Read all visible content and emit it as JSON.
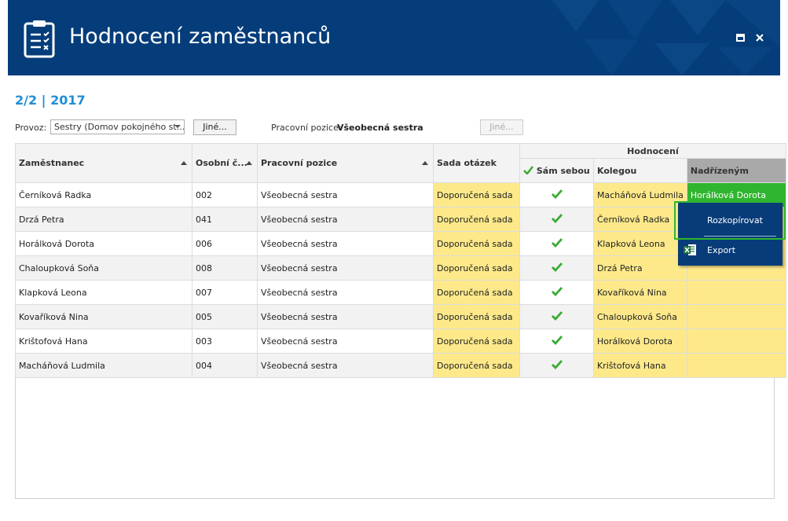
{
  "window": {
    "title": "Hodnocení zaměstnanců",
    "icon": "clipboard-checklist-icon",
    "controls": [
      "maximize-icon",
      "close-icon"
    ],
    "accent_color": "#053d7a"
  },
  "period": "2/2 | 2017",
  "filters": {
    "provoz_label": "Provoz:",
    "provoz_value": "Sestry (Domov pokojného st...",
    "provoz_button": "Jiné...",
    "pozice_label": "Pracovní pozice:",
    "pozice_value": "Všeobecná sestra",
    "pozice_button": "Jiné..."
  },
  "table": {
    "group_header": "Hodnocení",
    "headers": {
      "employee": "Zaměstnanec",
      "personal_no": "Osobní č...",
      "position": "Pracovní pozice",
      "question_set": "Sada otázek",
      "self": "Sám sebou",
      "colleague": "Kolegou",
      "superior": "Nadřízeným"
    },
    "rows": [
      {
        "employee": "Černíková Radka",
        "no": "002",
        "position": "Všeobecná sestra",
        "set": "Doporučená sada",
        "colleague": "Macháňová Ludmila",
        "superior": "Horálková Dorota"
      },
      {
        "employee": "Drzá Petra",
        "no": "041",
        "position": "Všeobecná sestra",
        "set": "Doporučená sada",
        "colleague": "Černíková Radka",
        "superior": ""
      },
      {
        "employee": "Horálková Dorota",
        "no": "006",
        "position": "Všeobecná sestra",
        "set": "Doporučená sada",
        "colleague": "Klapková Leona",
        "superior": ""
      },
      {
        "employee": "Chaloupková Soňa",
        "no": "008",
        "position": "Všeobecná sestra",
        "set": "Doporučená sada",
        "colleague": "Drzá Petra",
        "superior": ""
      },
      {
        "employee": "Klapková Leona",
        "no": "007",
        "position": "Všeobecná sestra",
        "set": "Doporučená sada",
        "colleague": "Kovaříková Nina",
        "superior": ""
      },
      {
        "employee": "Kovaříková Nina",
        "no": "005",
        "position": "Všeobecná sestra",
        "set": "Doporučená sada",
        "colleague": "Chaloupková Soňa",
        "superior": ""
      },
      {
        "employee": "Krištofová Hana",
        "no": "003",
        "position": "Všeobecná sestra",
        "set": "Doporučená sada",
        "colleague": "Horálková Dorota",
        "superior": ""
      },
      {
        "employee": "Macháňová Ludmila",
        "no": "004",
        "position": "Všeobecná sestra",
        "set": "Doporučená sada",
        "colleague": "Krištofová Hana",
        "superior": ""
      }
    ],
    "colors": {
      "yellow": "#fde98a",
      "green": "#2fb52f",
      "check": "#3aaa35"
    }
  },
  "context_menu": {
    "items": [
      {
        "label": "Rozkopírovat",
        "icon": ""
      },
      {
        "label": "Export",
        "icon": "excel-icon"
      }
    ]
  }
}
